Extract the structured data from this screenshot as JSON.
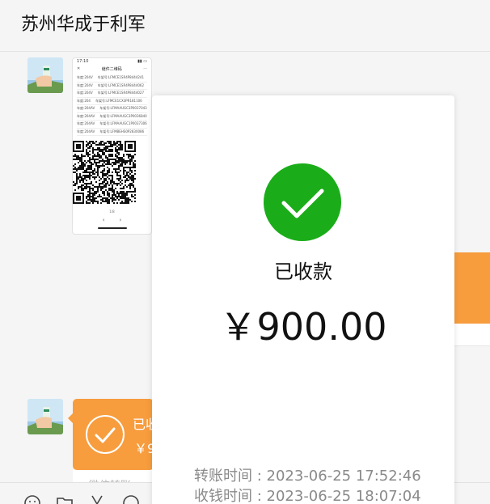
{
  "chat": {
    "title": "苏州华成于利军"
  },
  "image_message": {
    "status_time": "17:10",
    "nav_title": "继件二维码",
    "rows": [
      {
        "col1": "年度:204V",
        "col2": "车架号:LFMCE1SR4P8444241"
      },
      {
        "col1": "年度:204V",
        "col2": "车架号:LFMCE1SR4P8444062"
      },
      {
        "col1": "年度:204V",
        "col2": "车架号:LFMCE1SR4P8444027"
      },
      {
        "col1": "年度:204",
        "col2": "车架号:LFMCE1CX3PR181106"
      },
      {
        "col1": "年度:204AV",
        "col2": "车架号:LFMAAUGC3P0037043"
      },
      {
        "col1": "年度:204AV",
        "col2": "车架号:LFMAAUGC3P0036840"
      },
      {
        "col1": "年度:204AV",
        "col2": "车架号:LFMAAUGC1P0037306"
      },
      {
        "col1": "年度:204AV",
        "col2": "车架号:LFMBEHS0P2830086"
      }
    ],
    "footer": "1/8",
    "pager_prev": "‹",
    "pager_next": "›"
  },
  "transfer_bubble": {
    "line1": "已收",
    "line2": "￥9",
    "label": "微信转账"
  },
  "popup": {
    "status": "已收款",
    "amount": "￥900.00",
    "transfer_time": "转账时间 : 2023-06-25 17:52:46",
    "receive_time": "收钱时间 : 2023-06-25 18:07:04"
  },
  "icons": {
    "success": "check-circle-icon",
    "toolbar": [
      "emoji-icon",
      "folder-icon",
      "scissors-icon",
      "chat-icon"
    ]
  },
  "colors": {
    "success_green": "#1aad19",
    "transfer_orange": "#f79d3e"
  }
}
